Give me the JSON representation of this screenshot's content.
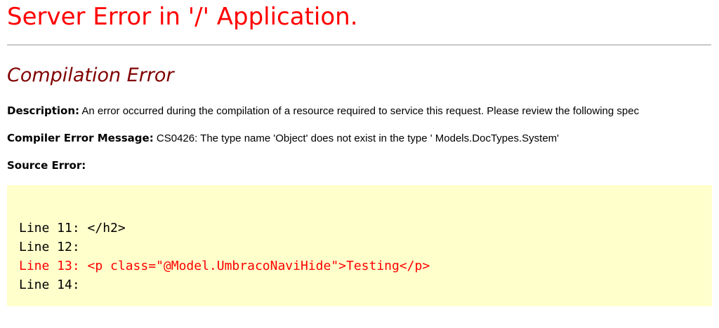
{
  "page": {
    "title": "Server Error in '/' Application.",
    "subtitle": "Compilation Error"
  },
  "description": {
    "label": "Description:",
    "text": " An error occurred during the compilation of a resource required to service this request. Please review the following spec"
  },
  "compiler_error": {
    "label": "Compiler Error Message:",
    "text": " CS0426: The type name 'Object' does not exist in the type ' Models.DocTypes.System'"
  },
  "source_error": {
    "label": "Source Error:"
  },
  "code_lines": [
    {
      "text": "Line 11: </h2>",
      "is_error": false
    },
    {
      "text": "Line 12:",
      "is_error": false
    },
    {
      "text": "Line 13: <p class=\"@Model.UmbracoNaviHide\">Testing</p>",
      "is_error": true
    },
    {
      "text": "Line 14:",
      "is_error": false
    }
  ],
  "colors": {
    "title": "#ff0000",
    "subtitle": "#800000",
    "code_background": "#ffffcc",
    "error_line": "#ff0000"
  }
}
